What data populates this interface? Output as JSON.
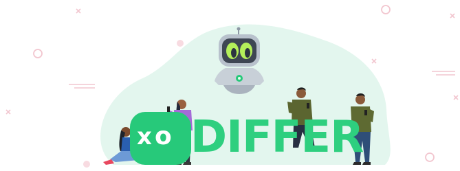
{
  "brand": {
    "wordmark": "DIFFER",
    "mark_glyph_1": "x",
    "mark_glyph_2": "o",
    "brand_color": "#2ecf7f",
    "blob_color": "#e3f6ee"
  },
  "illustration": {
    "mascot": "robot",
    "figures": [
      "person-sitting-with-phone",
      "woman-purple-shirt-phone",
      "man-olive-shirt-phone",
      "man-green-shirt-phone"
    ],
    "decorations": [
      "circle",
      "cross",
      "dash-lines"
    ]
  }
}
